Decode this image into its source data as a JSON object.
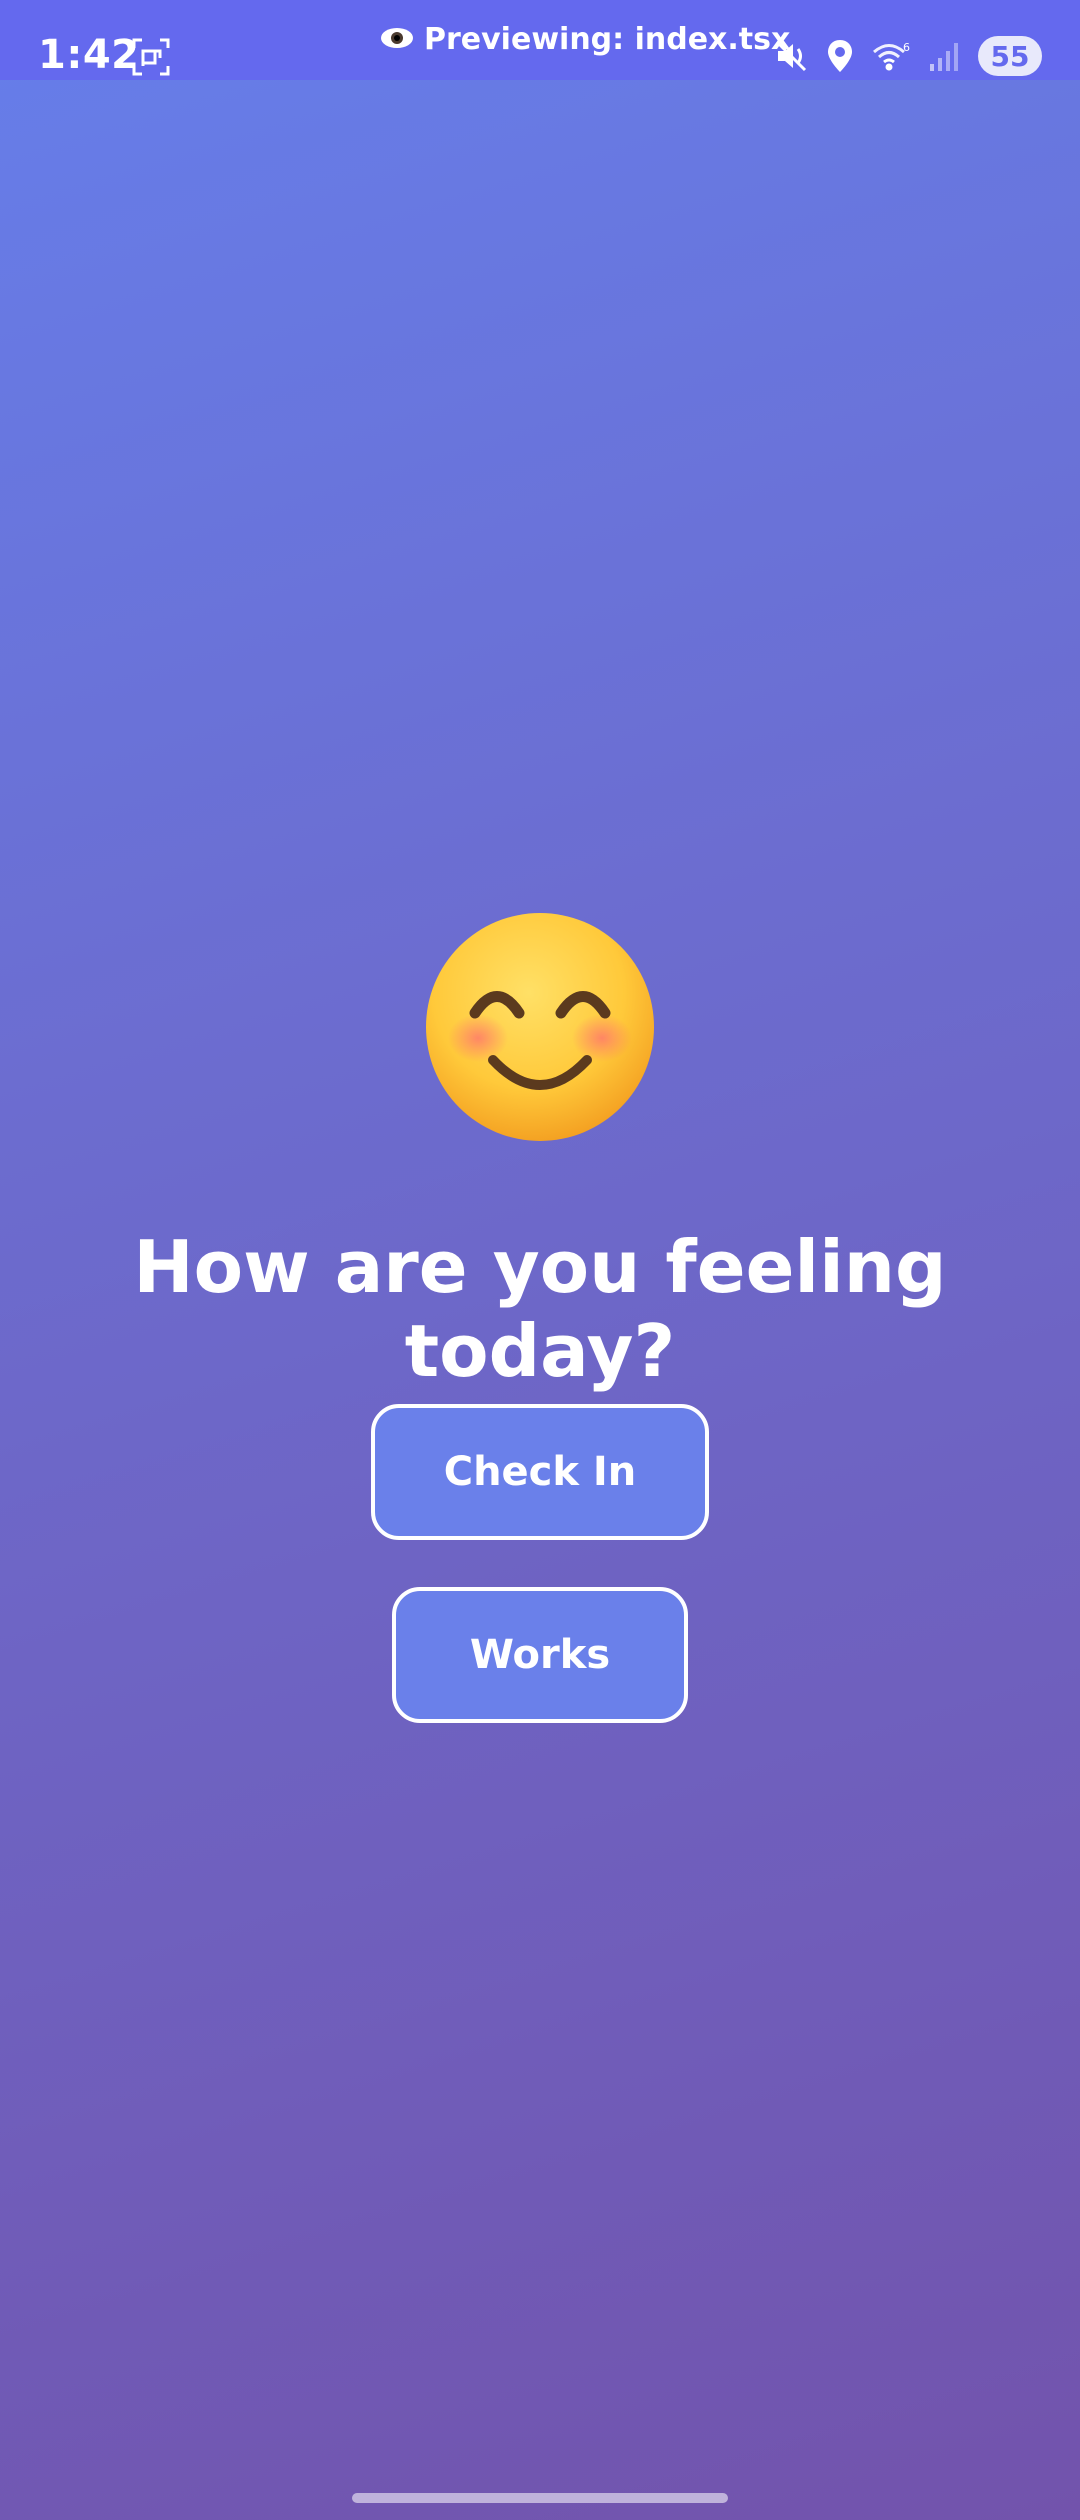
{
  "status_bar": {
    "time": "1:42",
    "preview_text": "Previewing: index.tsx",
    "battery_level": "55",
    "icons": [
      "screenshot-icon",
      "eye-icon",
      "mute-icon",
      "location-icon",
      "wifi-icon",
      "signal-icon"
    ]
  },
  "main": {
    "emoji": "smiling-face-with-smiling-eyes",
    "heading": "How are you feeling today?",
    "buttons": {
      "check_in": "Check In",
      "works": "Works"
    }
  },
  "colors": {
    "status_bar_bg": "#6469ee",
    "gradient_start": "#667eea",
    "gradient_end": "#7253ac",
    "button_bg": "#6a80ea",
    "text": "#ffffff"
  }
}
